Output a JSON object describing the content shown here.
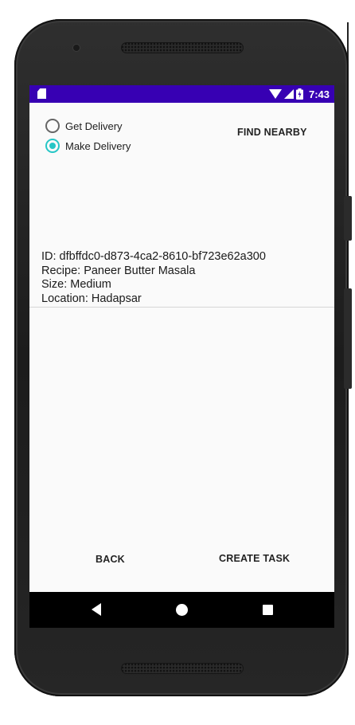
{
  "status_bar": {
    "time": "7:43",
    "icons": [
      "sd-card-icon",
      "wifi-icon",
      "signal-icon",
      "battery-icon"
    ]
  },
  "delivery_mode": {
    "options": [
      {
        "label": "Get Delivery",
        "checked": false
      },
      {
        "label": "Make Delivery",
        "checked": true
      }
    ]
  },
  "actions": {
    "find_nearby": "FIND NEARBY",
    "back": "BACK",
    "create_task": "CREATE TASK"
  },
  "order": {
    "id_line": "ID: dfbffdc0-d873-4ca2-8610-bf723e62a300",
    "recipe_line": "Recipe: Paneer Butter Masala",
    "size_line": "Size: Medium",
    "location_line": "Location: Hadapsar"
  },
  "colors": {
    "status_bar": "#3700b3",
    "radio_accent": "#26c6c6",
    "nav_bar": "#000000",
    "screen_bg": "#fafafa"
  },
  "nav_bar": {
    "icons": [
      "back-triangle-icon",
      "home-circle-icon",
      "recents-square-icon"
    ]
  }
}
